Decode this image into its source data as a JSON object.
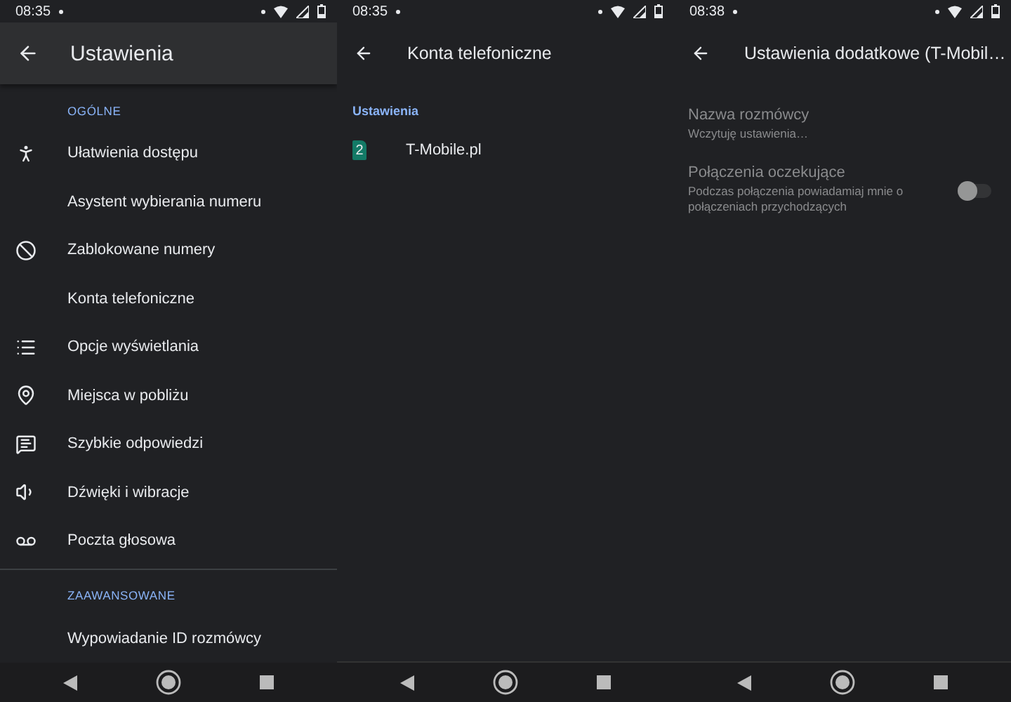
{
  "screens": [
    {
      "status": {
        "time": "08:35"
      },
      "title": "Ustawienia",
      "elevated": true,
      "sections": [
        {
          "header": "OGÓLNE",
          "items": [
            {
              "label": "Ułatwienia dostępu"
            },
            {
              "label": "Asystent wybierania numeru"
            },
            {
              "label": "Zablokowane numery"
            },
            {
              "label": "Konta telefoniczne"
            },
            {
              "label": "Opcje wyświetlania"
            },
            {
              "label": "Miejsca w pobliżu"
            },
            {
              "label": "Szybkie odpowiedzi"
            },
            {
              "label": "Dźwięki i wibracje"
            },
            {
              "label": "Poczta głosowa"
            }
          ]
        },
        {
          "header": "ZAAWANSOWANE",
          "items": [
            {
              "label": "Wypowiadanie ID rozmówcy"
            }
          ]
        }
      ]
    },
    {
      "status": {
        "time": "08:35"
      },
      "title": "Konta telefoniczne",
      "elevated": false,
      "accounts_header": "Ustawienia",
      "accounts": [
        {
          "sim": "2",
          "name": "T-Mobile.pl"
        }
      ]
    },
    {
      "status": {
        "time": "08:38"
      },
      "title": "Ustawienia dodatkowe (T-Mobil…",
      "elevated": false,
      "prefs": [
        {
          "kind": "text",
          "title": "Nazwa rozmówcy",
          "summary": "Wczytuję ustawienia…",
          "disabled": true
        },
        {
          "kind": "switch",
          "title": "Połączenia oczekujące",
          "summary": "Podczas połączenia powiadamiaj mnie o połączeniach przychodzących",
          "disabled": true,
          "on": false
        }
      ]
    }
  ]
}
